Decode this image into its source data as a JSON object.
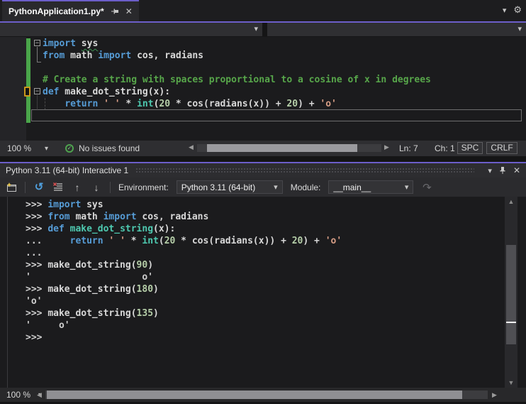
{
  "colors": {
    "accent": "#6c5ec9",
    "keyword": "#569cd6",
    "string": "#d69d85",
    "number": "#b5cea8",
    "function": "#4ec9b0",
    "comment": "#57a64a",
    "change_bar": "#4aa54a",
    "issues_ok": "#4ea24e"
  },
  "icons": {
    "chevron_down": "▾",
    "gear": "⚙",
    "close": "✕",
    "check": "✓",
    "reset": "↺",
    "history_previous": "↑",
    "history_next": "↓",
    "redo": "↷",
    "scroll_left": "◀",
    "scroll_right": "▶",
    "scroll_up": "▲",
    "scroll_down": "▼",
    "fold_minus": "−"
  },
  "editor_group": {
    "tab": {
      "title": "PythonApplication1.py*"
    },
    "nav_bar": {
      "left_value": "",
      "right_value": ""
    },
    "code_lines": [
      [
        [
          "kw",
          "import"
        ],
        [
          "pl",
          " "
        ],
        [
          "pl sq",
          "sys"
        ]
      ],
      [
        [
          "kw",
          "from"
        ],
        [
          "pl",
          " math "
        ],
        [
          "kw",
          "import"
        ],
        [
          "pl",
          " cos, radians"
        ]
      ],
      [],
      [
        [
          "com",
          "# Create a string with spaces proportional to a cosine of x in degrees"
        ]
      ],
      [
        [
          "kw",
          "def"
        ],
        [
          "pl",
          " make_dot_string(x):"
        ]
      ],
      [
        [
          "pl",
          "    "
        ],
        [
          "kw",
          "return"
        ],
        [
          "pl",
          " "
        ],
        [
          "str",
          "' '"
        ],
        [
          "pl",
          " * "
        ],
        [
          "fn",
          "int"
        ],
        [
          "pl",
          "("
        ],
        [
          "num",
          "20"
        ],
        [
          "pl",
          " * cos(radians(x)) + "
        ],
        [
          "num",
          "20"
        ],
        [
          "pl",
          ") + "
        ],
        [
          "str",
          "'o'"
        ]
      ],
      []
    ],
    "status_bar": {
      "zoom": "100 %",
      "issues_text": "No issues found",
      "line": "Ln: 7",
      "column": "Ch: 1",
      "spaces": "SPC",
      "line_ending": "CRLF"
    }
  },
  "interactive": {
    "title": "Python 3.11 (64-bit) Interactive 1",
    "toolbar": {
      "environment_label": "Environment:",
      "environment_value": "Python 3.11 (64-bit)",
      "module_label": "Module:",
      "module_value": "__main__"
    },
    "repl_lines": [
      [
        [
          "pr",
          ">>> "
        ],
        [
          "kw",
          "import"
        ],
        [
          "pl",
          " sys"
        ]
      ],
      [
        [
          "pr",
          ">>> "
        ],
        [
          "kw",
          "from"
        ],
        [
          "pl",
          " math "
        ],
        [
          "kw",
          "import"
        ],
        [
          "pl",
          " cos, radians"
        ]
      ],
      [
        [
          "pr",
          ">>> "
        ],
        [
          "kw",
          "def"
        ],
        [
          "fn",
          " make_dot_string"
        ],
        [
          "pl",
          "(x):"
        ]
      ],
      [
        [
          "pr",
          "... "
        ],
        [
          "pl",
          "    "
        ],
        [
          "kw",
          "return"
        ],
        [
          "pl",
          " "
        ],
        [
          "str",
          "' '"
        ],
        [
          "pl",
          " * "
        ],
        [
          "fn",
          "int"
        ],
        [
          "pl",
          "("
        ],
        [
          "num",
          "20"
        ],
        [
          "pl",
          " * cos(radians(x)) + "
        ],
        [
          "num",
          "20"
        ],
        [
          "pl",
          ") + "
        ],
        [
          "str",
          "'o'"
        ]
      ],
      [
        [
          "pr",
          "..."
        ]
      ],
      [
        [
          "pr",
          ">>> "
        ],
        [
          "pl",
          "make_dot_string("
        ],
        [
          "num",
          "90"
        ],
        [
          "pl",
          ")"
        ]
      ],
      [
        [
          "out",
          "'                    o'"
        ]
      ],
      [
        [
          "pr",
          ">>> "
        ],
        [
          "pl",
          "make_dot_string("
        ],
        [
          "num",
          "180"
        ],
        [
          "pl",
          ")"
        ]
      ],
      [
        [
          "out",
          "'o'"
        ]
      ],
      [
        [
          "pr",
          ">>> "
        ],
        [
          "pl",
          "make_dot_string("
        ],
        [
          "num",
          "135"
        ],
        [
          "pl",
          ")"
        ]
      ],
      [
        [
          "out",
          "'     o'"
        ]
      ],
      [
        [
          "pr",
          ">>>"
        ]
      ]
    ],
    "status_bar": {
      "zoom": "100 %"
    }
  }
}
